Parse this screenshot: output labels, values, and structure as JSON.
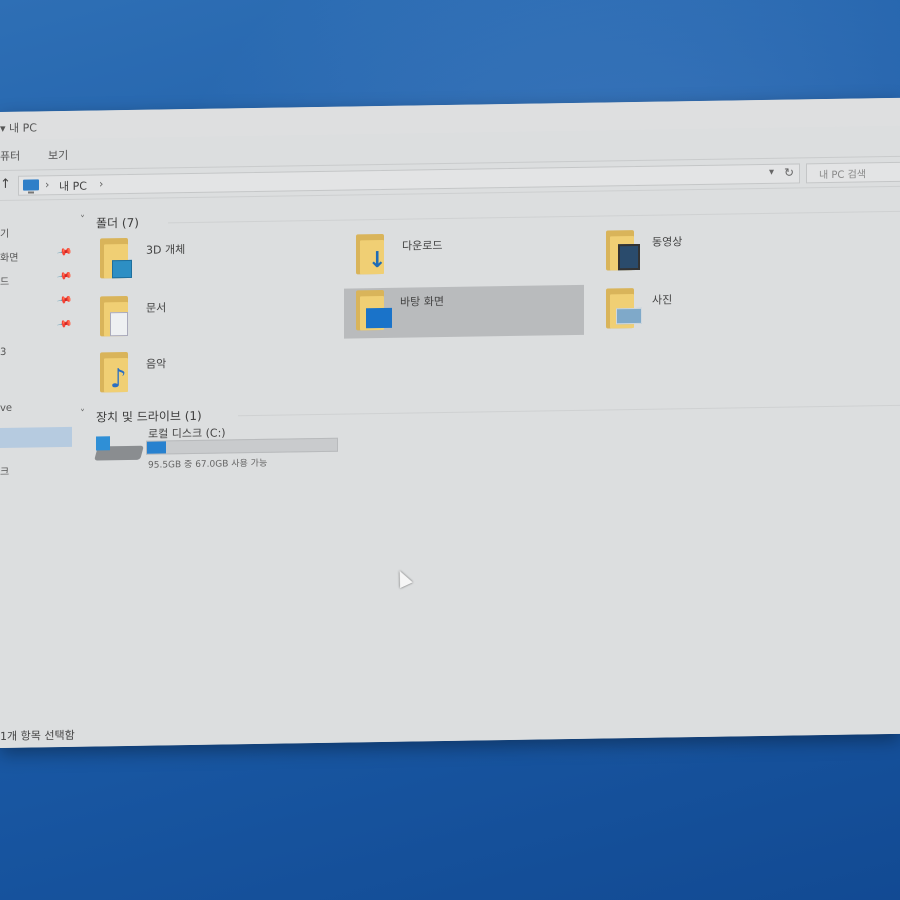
{
  "window": {
    "title": "내 PC",
    "title_prefix_icon": "down-arrow-icon"
  },
  "ribbon": {
    "tabs": [
      "퓨터",
      "보기"
    ]
  },
  "address": {
    "location": "내 PC",
    "search_placeholder": "내 PC 검색",
    "nav_icon": "up-arrow-icon"
  },
  "sidebar": {
    "items": [
      {
        "label": "기",
        "pinned": false
      },
      {
        "label": "화면",
        "pinned": true
      },
      {
        "label": "드",
        "pinned": true
      },
      {
        "label": "",
        "pinned": true
      },
      {
        "label": "",
        "pinned": true
      },
      {
        "label": "3",
        "pinned": false
      },
      {
        "label": "ve",
        "pinned": false
      },
      {
        "label": "",
        "pinned": false,
        "selected": true
      },
      {
        "label": "크",
        "pinned": false
      }
    ]
  },
  "sections": {
    "folders": {
      "title": "폴더 (7)"
    },
    "drives": {
      "title": "장치 및 드라이브 (1)"
    }
  },
  "folders": [
    {
      "label": "3D 개체",
      "icon": "3d-objects-folder-icon"
    },
    {
      "label": "다운로드",
      "icon": "downloads-folder-icon"
    },
    {
      "label": "동영상",
      "icon": "videos-folder-icon"
    },
    {
      "label": "문서",
      "icon": "documents-folder-icon"
    },
    {
      "label": "바탕 화면",
      "icon": "desktop-folder-icon",
      "selected": true
    },
    {
      "label": "사진",
      "icon": "pictures-folder-icon"
    },
    {
      "label": "음악",
      "icon": "music-folder-icon"
    }
  ],
  "drive": {
    "label": "로컬 디스크 (C:)",
    "free_text": "95.5GB 중 67.0GB 사용 가능",
    "used_fraction": 0.1
  },
  "status": {
    "text": "1개 항목 선택함"
  },
  "colors": {
    "accent": "#2781cf",
    "selection": "#b9bbbd",
    "desktop": "#1f5ea8"
  }
}
